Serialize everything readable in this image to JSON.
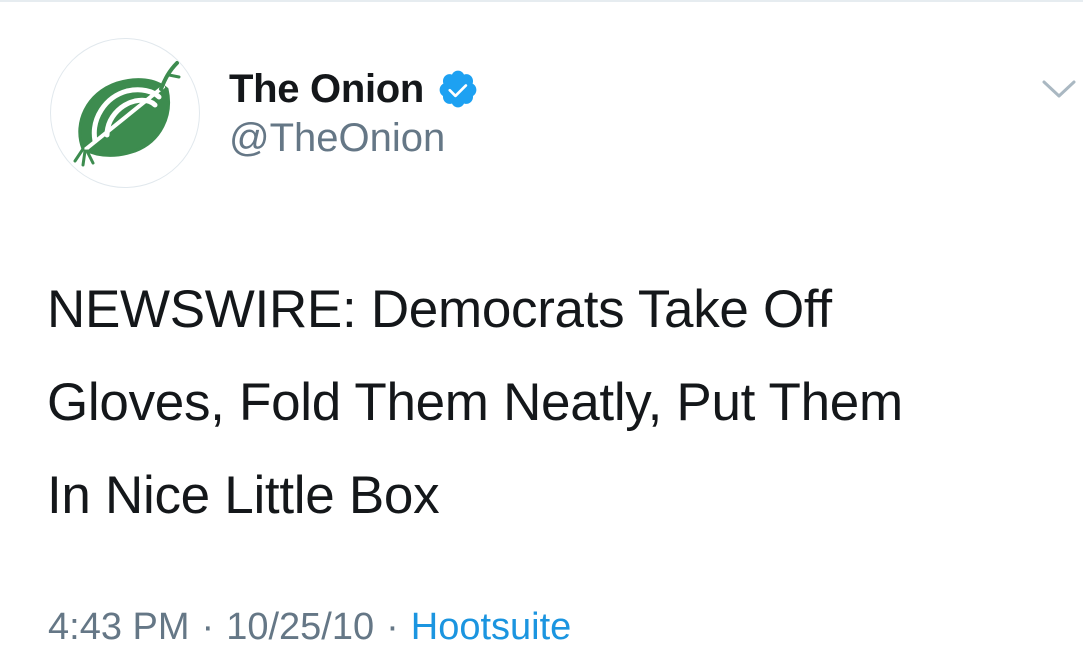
{
  "tweet": {
    "author": {
      "display_name": "The Onion",
      "handle": "@TheOnion",
      "verified": true,
      "avatar_icon": "onion-logo-icon"
    },
    "text_lines": [
      "NEWSWIRE: Democrats Take Off",
      "Gloves, Fold Them Neatly, Put Them",
      "In Nice Little Box"
    ],
    "meta": {
      "time": "4:43 PM",
      "separator": "·",
      "date": "10/25/10",
      "source": "Hootsuite"
    },
    "menu_icon": "chevron-down-icon"
  },
  "colors": {
    "onion_green": "#3d8c4f",
    "verified_blue": "#1da1f2",
    "link_blue": "#1b95e0",
    "muted_gray": "#657786",
    "text": "#14171a"
  }
}
